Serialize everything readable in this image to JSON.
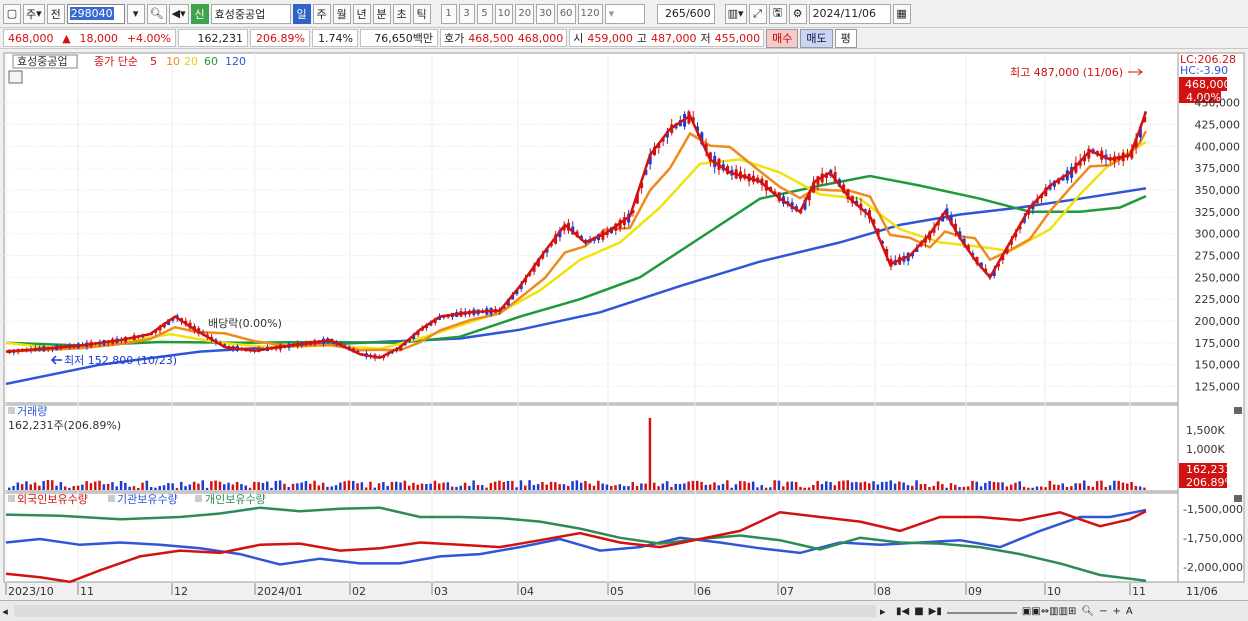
{
  "toolbar": {
    "market_type": "주",
    "period_sel": "전",
    "stock_code": "298040",
    "new_badge": "신",
    "stock_name": "효성중공업",
    "period_tabs": [
      "일",
      "주",
      "월",
      "년",
      "분",
      "초",
      "틱"
    ],
    "active_tab": "일",
    "interval_buttons": [
      "1",
      "3",
      "5",
      "10",
      "20",
      "30",
      "60",
      "120"
    ],
    "count_value": "265",
    "count_max": "/600",
    "date_value": "2024/11/06"
  },
  "quote": {
    "price": "468,000",
    "change_arrow": "▲",
    "change": "18,000",
    "change_pct": "+4.00%",
    "volume": "162,231",
    "volume_ratio": "206.89%",
    "turnover": "1.74%",
    "amount": "76,650백만",
    "ask_label": "호가",
    "ask1": "468,500",
    "ask2": "468,000",
    "open_label": "시",
    "open": "459,000",
    "high_label": "고",
    "high": "487,000",
    "low_label": "저",
    "low": "455,000",
    "buy_label": "매수",
    "sell_label": "매도",
    "eval_label": "평"
  },
  "price_panel": {
    "name_label": "효성중공업",
    "ma_label": "종가 단순",
    "ma_periods": [
      {
        "label": "5",
        "color": "#d21111"
      },
      {
        "label": "10",
        "color": "#f08a1c"
      },
      {
        "label": "20",
        "color": "#f2e20c"
      },
      {
        "label": "60",
        "color": "#1e9a3a"
      },
      {
        "label": "120",
        "color": "#2f56d6"
      }
    ],
    "lc_label": "LC:206.28",
    "hc_label": "HC:-3.90",
    "current_tag": "468,000",
    "current_pct_tag": "4.00%",
    "high_annotation": "최고 487,000 (11/06)",
    "low_annotation": "최저 152,800 (10/23)",
    "dividend_annotation": "배당락(0.00%)",
    "y_ticks": [
      "450,000",
      "425,000",
      "400,000",
      "375,000",
      "350,000",
      "325,000",
      "300,000",
      "275,000",
      "250,000",
      "225,000",
      "200,000",
      "175,000",
      "150,000",
      "125,000"
    ]
  },
  "volume_panel": {
    "title": "거래량",
    "value_label": "162,231주(206.89%)",
    "y_ticks": [
      "1,500K",
      "1,000K"
    ],
    "current_tag": "162,231",
    "current_pct_tag": "206.89%"
  },
  "holding_panel": {
    "legend": [
      {
        "label": "외국인보유수량",
        "color": "#d21111"
      },
      {
        "label": "기관보유수량",
        "color": "#2f56d6"
      },
      {
        "label": "개인보유수량",
        "color": "#2e8b57"
      }
    ],
    "y_ticks": [
      "-1,500,000",
      "-1,750,000",
      "-2,000,000"
    ]
  },
  "x_axis": {
    "labels": [
      "2023/10",
      "11",
      "12",
      "2024/01",
      "02",
      "03",
      "04",
      "05",
      "06",
      "07",
      "08",
      "09",
      "10",
      "11"
    ],
    "right_label": "11/06"
  },
  "colors": {
    "ma5": "#d21111",
    "ma10": "#f08a1c",
    "ma20": "#f2e20c",
    "ma60": "#1e9a3a",
    "ma120": "#2f56d6",
    "up": "#d21111",
    "down": "#1d3bd1"
  }
}
